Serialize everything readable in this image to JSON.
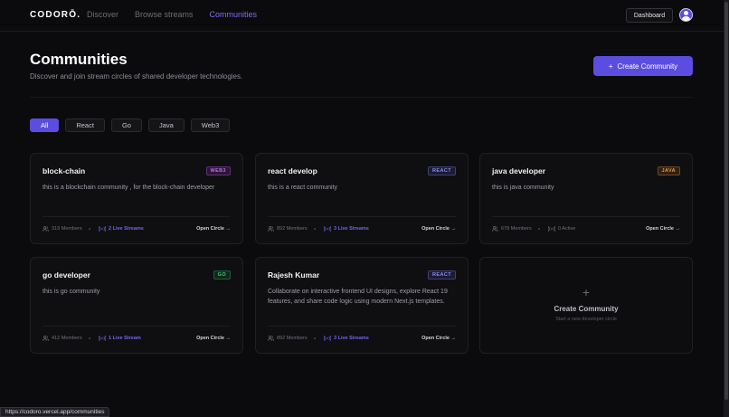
{
  "nav": {
    "logo": "CODORŌ.",
    "links": [
      {
        "label": "Discover"
      },
      {
        "label": "Browse streams"
      },
      {
        "label": "Communities"
      }
    ],
    "active_index": 2,
    "dashboard_label": "Dashboard"
  },
  "header": {
    "title": "Communities",
    "subtitle": "Discover and join stream circles of shared developer technologies.",
    "create_button_label": "Create Community"
  },
  "filters": [
    "All",
    "React",
    "Go",
    "Java",
    "Web3"
  ],
  "active_filter": "All",
  "cards": [
    {
      "title": "block-chain",
      "tag": "WEB3",
      "tag_color": "#c26cf0",
      "tag_bg": "#2a1535",
      "desc": "this is a blockchain community , for the block-chain developer",
      "members": "319 Members",
      "streams": "2 Live Streams",
      "streams_live": true,
      "open_label": "Open Circle →"
    },
    {
      "title": "react develop",
      "tag": "REACT",
      "tag_color": "#8b8bf0",
      "tag_bg": "#1b1b33",
      "desc": "this is a react community",
      "members": "892 Members",
      "streams": "3 Live Streams",
      "streams_live": true,
      "open_label": "Open Circle →"
    },
    {
      "title": "java developer",
      "tag": "JAVA",
      "tag_color": "#e09a4a",
      "tag_bg": "#30200f",
      "desc": "this is java community",
      "members": "678 Members",
      "streams": "0 Active",
      "streams_live": false,
      "open_label": "Open Circle →"
    },
    {
      "title": "go developer",
      "tag": "GO",
      "tag_color": "#4ec27a",
      "tag_bg": "#10281a",
      "desc": "this is go community",
      "members": "412 Members",
      "streams": "1 Live Stream",
      "streams_live": true,
      "open_label": "Open Circle →"
    },
    {
      "title": "Rajesh Kumar",
      "tag": "REACT",
      "tag_color": "#8b8bf0",
      "tag_bg": "#1b1b33",
      "desc": "Collaborate on interactive frontend UI designs, explore React 19 features, and share code logic using modern Next.js templates.",
      "members": "892 Members",
      "streams": "3 Live Streams",
      "streams_live": true,
      "open_label": "Open Circle →"
    }
  ],
  "new_card": {
    "plus": "+",
    "title": "Create Community",
    "subtitle": "Start a new developer circle"
  },
  "status_url": "https://codoro.vercel.app/communities",
  "colors": {
    "accent": "#5b4de0",
    "active_link": "#7b6cf6",
    "background": "#0b0b0d"
  }
}
